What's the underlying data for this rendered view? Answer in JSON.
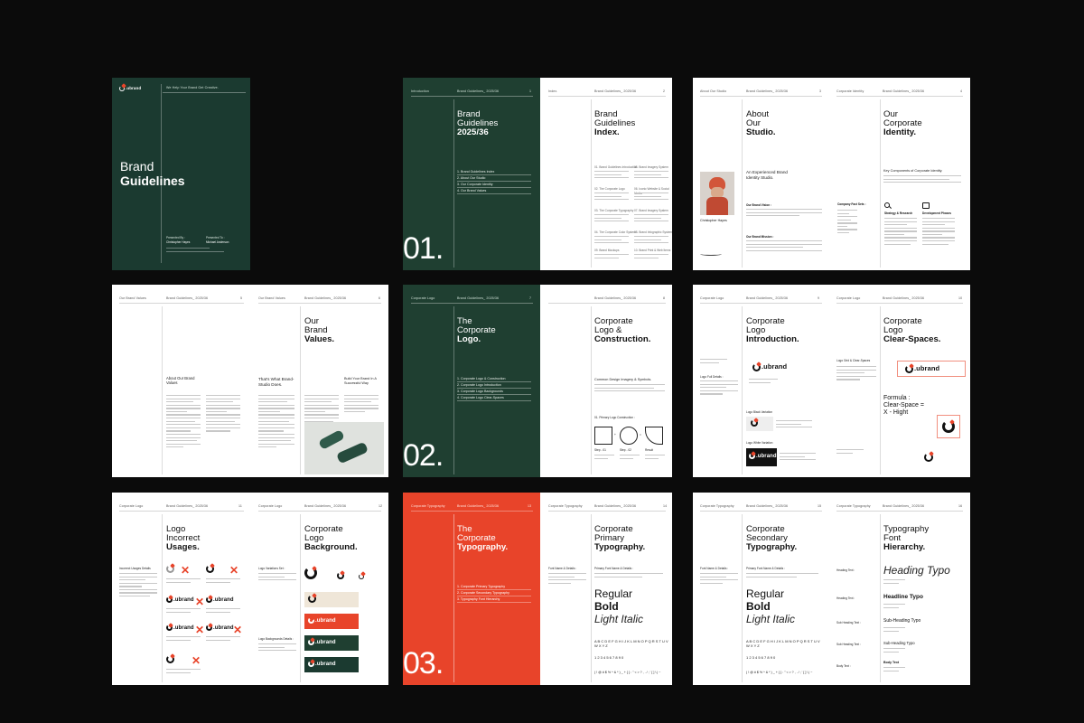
{
  "cover": {
    "tagline": "We Help Your Brand Get Creative.",
    "logo": ".ubrand",
    "title_line1": "Brand",
    "title_line2": "Guidelines",
    "presented_by_label": "Presented By :",
    "presented_by_name": "Christopher Hayes",
    "presented_to_label": "Presented To :",
    "presented_to_name": "Michael Anderson"
  },
  "spread1": {
    "hdr_left": "Introduction",
    "hdr_mid": "Brand Guidelines_ 2025/36",
    "hdr_num_left": "1",
    "title_line1": "Brand",
    "title_line2": "Guidelines",
    "title_line3": "2025/36",
    "toc": [
      "1. Brand Guidelines Index",
      "2. About Our Studio",
      "3. Our Corporate Identity",
      "4. Our Brand Values"
    ],
    "bignum": "01.",
    "hdr_right_left": "Index.",
    "hdr_right_mid": "Brand Guidelines_ 2025/36",
    "hdr_num_right": "2",
    "index_title_line1": "Brand",
    "index_title_line2": "Guidelines",
    "index_title_line3": "Index.",
    "index_items": [
      "01. Brand Guidelines Introduction",
      "05. Brand Imagery System",
      "02. The Corporate Logo",
      "06. Iconic Website & Social Media",
      "03. The Corporate Typography",
      "07. Brand Imagery System",
      "04. The Corporate Color System",
      "08. Brand Infographic System",
      "09. Brand Mockups",
      "10. Brand Print & Web Items"
    ]
  },
  "spread2": {
    "hdr_left": "About Our Studio",
    "hdr_mid": "Brand Guidelines_ 2025/36",
    "hdr_num_left": "3",
    "title_line1": "About",
    "title_line2": "Our",
    "title_line3": "Studio.",
    "subtitle": "An Experienced Brand Identity Studio.",
    "person_name": "Christopher Hayes",
    "brand_vision": "Our Brand Vision :",
    "brand_mission": "Our Brand Mission :",
    "hdr_right_left": "Corporate Identity",
    "hdr_right_mid": "Brand Guidelines_ 2025/36",
    "hdr_num_right": "4",
    "right_title_line1": "Our",
    "right_title_line2": "Corporate",
    "right_title_line3": "Identity.",
    "key_components": "Key Components of Corporate Identity.",
    "company_facts": "Company Fact Sets :",
    "strategy": "Strategy & Research",
    "development": "Development Phases"
  },
  "spread3": {
    "hdr_left": "Our Brand Values",
    "hdr_mid": "Brand Guidelines_ 2025/36",
    "hdr_num_left": "5",
    "about_brand": "About Our Brand Values",
    "hdr_right_left": "Our Brand Values",
    "hdr_right_mid": "Brand Guidelines_ 2025/36",
    "hdr_num_right": "6",
    "title_line1": "Our",
    "title_line2": "Brand",
    "title_line3": "Values.",
    "thats_what": "That's What Brand-Studio Does.",
    "build_brand": "Build Your Brand In A Successful Way"
  },
  "spread4": {
    "hdr_left": "Corporate Logo",
    "hdr_mid": "Brand Guidelines_ 2025/36",
    "hdr_num_left": "7",
    "title_line1": "The",
    "title_line2": "Corporate",
    "title_line3": "Logo.",
    "toc": [
      "1. Corporate Logo & Construction",
      "2. Corporate Logo Introduction",
      "3. Corporate Logo Backgrounds",
      "4. Corporate Logo Clear-Spaces"
    ],
    "bignum": "02.",
    "hdr_right_mid": "Brand Guidelines_ 2025/36",
    "hdr_num_right": "8",
    "right_title_line1": "Corporate",
    "right_title_line2": "Logo &",
    "right_title_line3": "Construction.",
    "common_design": "Common Design Imagery & Symbols.",
    "primary_logo": "01. Primary Logo Construction :",
    "steps": [
      "Step - 01",
      "Step - 02",
      "Result"
    ]
  },
  "spread5": {
    "hdr_left": "Corporate Logo",
    "hdr_mid": "Brand Guidelines_ 2025/36",
    "hdr_num_left": "9",
    "title_line1": "Corporate",
    "title_line2": "Logo",
    "title_line3": "Introduction.",
    "logo": ".ubrand",
    "logo_full_details": "Logo Full Details :",
    "logo_black_variation": "Logo Black Variation",
    "logo_white_variation": "Logo White Variation",
    "hdr_right_left": "Corporate Logo",
    "hdr_right_mid": "Brand Guidelines_ 2025/36",
    "hdr_num_right": "10",
    "right_title_line1": "Corporate",
    "right_title_line2": "Logo",
    "right_title_line3": "Clear-Spaces.",
    "logo_clear_spaces": "Logo Grid & Clear-Spaces",
    "formula_line1": "Formula :",
    "formula_line2": "Clear-Space =",
    "formula_line3": "X - Hight"
  },
  "spread6": {
    "hdr_left": "Corporate Logo",
    "hdr_mid": "Brand Guidelines_ 2025/36",
    "hdr_num_left": "11",
    "title_line1": "Logo",
    "title_line2": "Incorrect",
    "title_line3": "Usages.",
    "incorrect_label": "Incorrect Usages Details",
    "logo": ".ubrand",
    "hdr_right_left": "Corporate Logo",
    "hdr_right_mid": "Brand Guidelines_ 2025/36",
    "hdr_num_right": "12",
    "right_title_line1": "Corporate",
    "right_title_line2": "Logo",
    "right_title_line3": "Background.",
    "logo_variations": "Logo Variations Set :",
    "logo_backgrounds": "Logo Backgrounds Details :"
  },
  "spread7": {
    "hdr_left": "Corporate Typography",
    "hdr_mid": "Brand Guidelines_ 2025/36",
    "hdr_num_left": "13",
    "title_line1": "The",
    "title_line2": "Corporate",
    "title_line3": "Typography.",
    "toc": [
      "1. Corporate Primary Typography",
      "2. Corporate Secondary Typography",
      "3. Typography Font Hierarchy"
    ],
    "bignum": "03.",
    "hdr_right_left": "Corporate Typography",
    "hdr_right_mid": "Brand Guidelines_ 2025/36",
    "hdr_num_right": "14",
    "right_title_line1": "Corporate",
    "right_title_line2": "Primary",
    "right_title_line3": "Typography.",
    "font_name": "Font Name & Details :",
    "primary_font_name": "Primary Font Name & Details :",
    "regular": "Regular",
    "bold": "Bold",
    "light_italic": "Light Italic",
    "alphabet": "A B C D E F G H I J K L M N O P Q R S T U V W X Y Z",
    "digits": "1 2 3 4 5 6 7 8 9 0",
    "symbols": "( ! @ # $ % ^ & * ) _ + { } : \" < > ? , . / ; ' [ ] \\ | ~"
  },
  "spread8": {
    "hdr_left": "Corporate Typography",
    "hdr_mid": "Brand Guidelines_ 2025/36",
    "hdr_num_left": "15",
    "title_line1": "Corporate",
    "title_line2": "Secondary",
    "title_line3": "Typography.",
    "font_name": "Font Name & Details :",
    "secondary_font_name": "Primary Font Name & Details :",
    "regular": "Regular",
    "bold": "Bold",
    "light_italic": "Light Italic",
    "alphabet": "A B C D E F G H I J K L M N O P Q R S T U V W X Y Z",
    "digits": "1 2 3 4 5 6 7 8 9 0",
    "symbols": "( ! @ # $ % ^ & * ) _ + { } : \" < > ? , . / ; ' [ ] \\ | ~",
    "hdr_right_left": "Corporate Typography",
    "hdr_right_mid": "Brand Guidelines_ 2025/36",
    "hdr_num_right": "16",
    "right_title_line1": "Typography",
    "right_title_line2": "Font",
    "right_title_line3": "Hierarchy.",
    "heading_text": "Heading Text :",
    "heading_typo": "Heading Typo",
    "headline_typo": "Headline Typo",
    "sub_heading_text": "Sub Heading Text :",
    "sub_heading_typo": "Sub-Heading Typo",
    "sub_heading_typo2": "Sub-Heading Typo",
    "body_text": "Body Text :",
    "body_typo": "Body Text"
  },
  "colors": {
    "background": "#0b0b0b",
    "green": "#1f3f31",
    "dark_green": "#1b3a30",
    "red": "#e8442a",
    "beige": "#efe6d8"
  }
}
